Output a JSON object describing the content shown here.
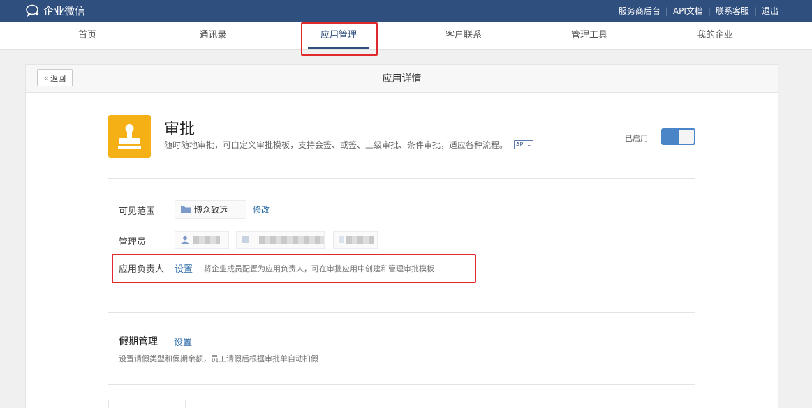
{
  "topbar": {
    "brand": "企业微信",
    "links": [
      "服务商后台",
      "API文档",
      "联系客服",
      "退出"
    ]
  },
  "nav": {
    "items": [
      "首页",
      "通讯录",
      "应用管理",
      "客户联系",
      "管理工具",
      "我的企业"
    ],
    "active": "应用管理"
  },
  "card": {
    "back_label": "返回",
    "title": "应用详情"
  },
  "app": {
    "name": "审批",
    "description": "随时随地审批，可自定义审批模板，支持会签、或签、上级审批、条件审批，适应各种流程。",
    "api_badge": "API",
    "status_label": "已启用",
    "enabled": true,
    "icon": "stamp-icon",
    "icon_color": "#f5b016"
  },
  "visibility": {
    "label": "可见范围",
    "department": "博众致远",
    "modify_label": "修改"
  },
  "admins": {
    "label": "管理员"
  },
  "owner": {
    "label": "应用负责人",
    "set_label": "设置",
    "hint": "将企业成员配置为应用负责人，可在审批应用中创建和管理审批模板"
  },
  "holiday": {
    "title": "假期管理",
    "set_label": "设置",
    "description": "设置请假类型和假期余额，员工请假后根据审批单自动扣假"
  },
  "colors": {
    "topbar": "#2f4f7f",
    "accent": "#2f4f7f",
    "link": "#2a6aa8",
    "toggle_on": "#4a86c7",
    "highlight": "#e0282d"
  }
}
